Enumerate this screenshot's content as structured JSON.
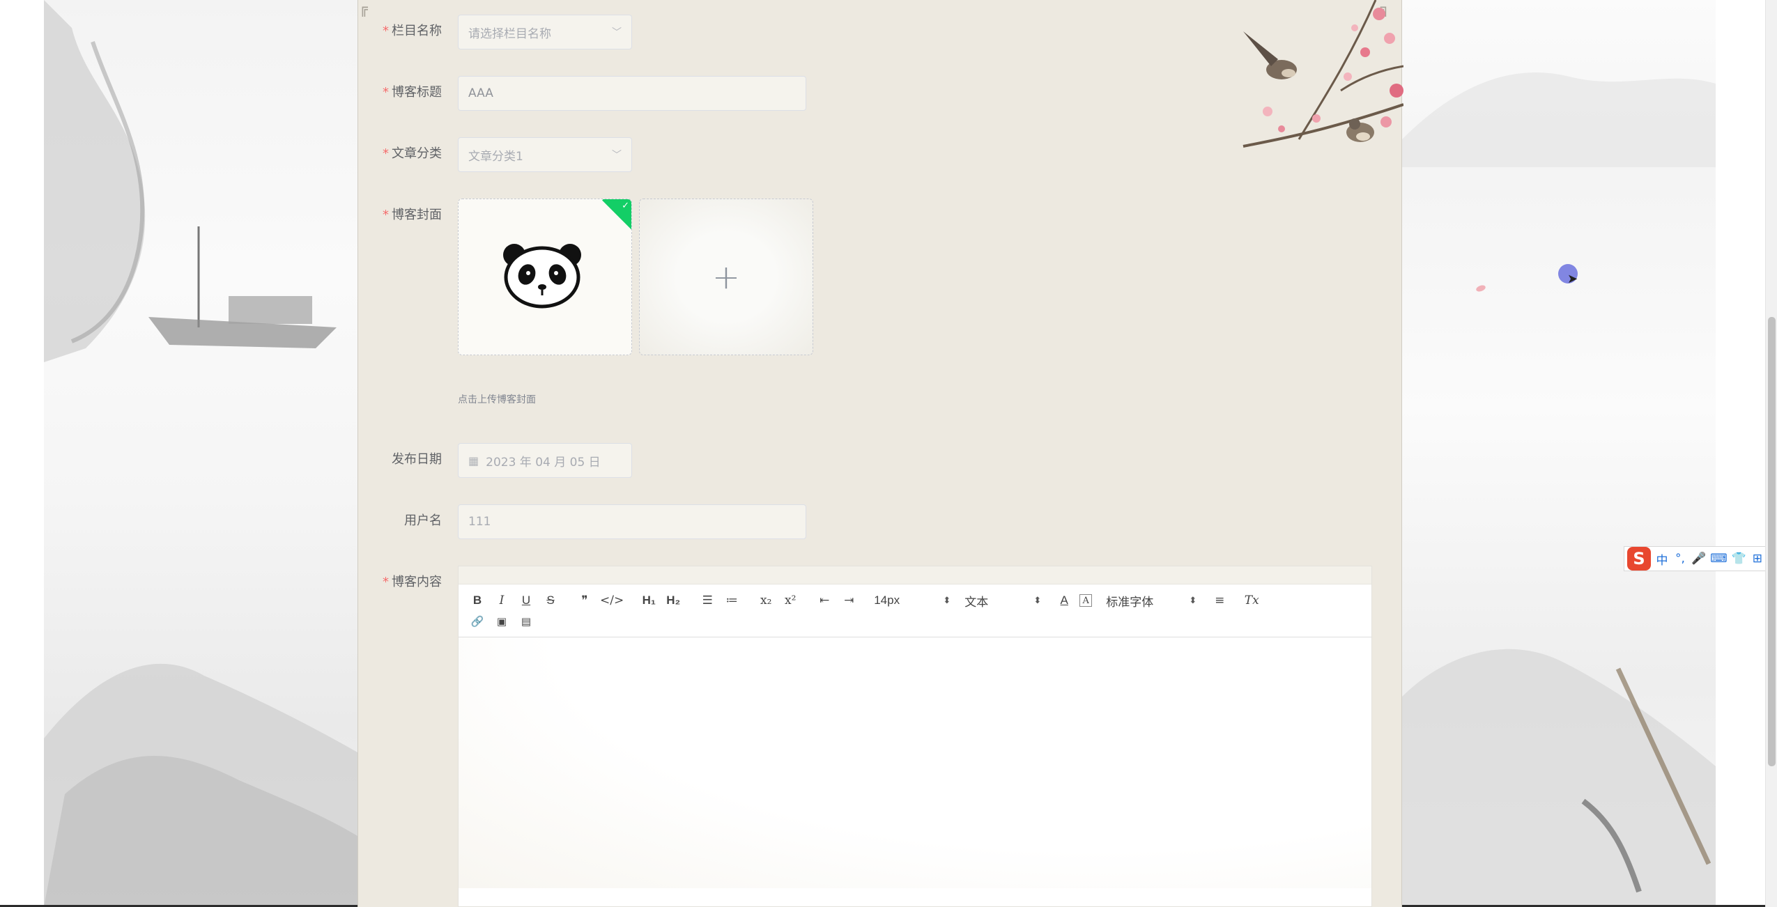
{
  "form": {
    "column": {
      "label": "栏目名称",
      "placeholder": "请选择栏目名称",
      "required": true
    },
    "title": {
      "label": "博客标题",
      "value": "AAA",
      "required": true
    },
    "category": {
      "label": "文章分类",
      "value": "文章分类1",
      "required": true
    },
    "cover": {
      "label": "博客封面",
      "tip": "点击上传博客封面",
      "add_symbol": "+",
      "required": true
    },
    "publish_date": {
      "label": "发布日期",
      "value": "2023 年 04 月 05 日"
    },
    "username": {
      "label": "用户名",
      "value": "111"
    },
    "content": {
      "label": "博客内容",
      "required": true
    }
  },
  "required_mark": "*",
  "editor": {
    "buttons_row1": [
      {
        "name": "bold-button",
        "label": "B",
        "cls": "b"
      },
      {
        "name": "italic-button",
        "label": "I",
        "cls": "i"
      },
      {
        "name": "underline-button",
        "label": "U",
        "cls": "u"
      },
      {
        "name": "strike-button",
        "label": "S",
        "cls": "s"
      },
      {
        "name": "sep"
      },
      {
        "name": "blockquote-button",
        "label": "❞",
        "cls": ""
      },
      {
        "name": "code-block-button",
        "label": "</>",
        "cls": "code"
      },
      {
        "name": "sep"
      },
      {
        "name": "header1-button",
        "label": "H₁",
        "cls": "b"
      },
      {
        "name": "header2-button",
        "label": "H₂",
        "cls": "b"
      },
      {
        "name": "sep"
      },
      {
        "name": "ordered-list-button",
        "label": "☰",
        "cls": ""
      },
      {
        "name": "bullet-list-button",
        "label": "≔",
        "cls": ""
      },
      {
        "name": "sep"
      },
      {
        "name": "subscript-button",
        "label": "x₂",
        "cls": ""
      },
      {
        "name": "superscript-button",
        "label": "x²",
        "cls": ""
      },
      {
        "name": "sep"
      },
      {
        "name": "outdent-button",
        "label": "⇤",
        "cls": ""
      },
      {
        "name": "indent-button",
        "label": "⇥",
        "cls": ""
      }
    ],
    "size_select": "14px",
    "header_select": "文本",
    "font_select": "标准字体",
    "color_icon": "A",
    "background_icon": "A",
    "align_icon": "≡",
    "clean_icon": "Tx",
    "buttons_row2": [
      {
        "name": "link-button",
        "label": "🔗"
      },
      {
        "name": "image-button",
        "label": "▣"
      },
      {
        "name": "video-button",
        "label": "▤"
      }
    ]
  },
  "ime": {
    "logo": "S",
    "items": [
      "中",
      "°,",
      "🎤",
      "⌨",
      "👕",
      "⊞"
    ]
  },
  "colors": {
    "required": "#f56c6c",
    "upload_badge": "#13ce66",
    "panel_bg": "#ede9e0"
  },
  "icons": {
    "select_arrow": "chevron-down-icon",
    "date": "calendar-icon",
    "upload_success": "check-icon"
  }
}
